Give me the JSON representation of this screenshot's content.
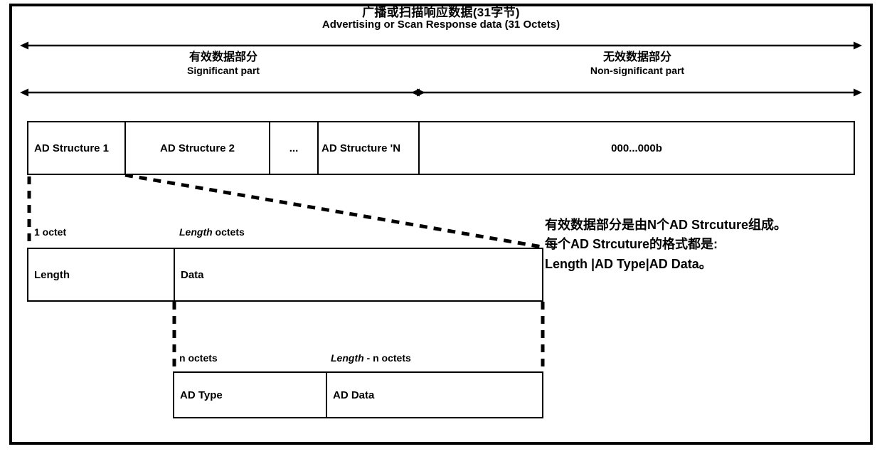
{
  "diagram": {
    "title": {
      "cn": "广播或扫描响应数据(31字节)",
      "en": "Advertising or Scan Response data (31 Octets)"
    },
    "parts": [
      {
        "cn": "有效数据部分",
        "en": "Significant part"
      },
      {
        "cn": "无效数据部分",
        "en": "Non-significant part"
      }
    ],
    "payload_row": {
      "cells": [
        "AD Structure 1",
        "AD Structure 2",
        "...",
        "AD Structure 'N",
        "000...000b"
      ]
    },
    "ad_structure_table": {
      "captions": [
        {
          "plain_before": "1 octet",
          "italic": "",
          "plain_after": ""
        },
        {
          "plain_before": "",
          "italic": "Length",
          "plain_after": " octets"
        }
      ],
      "cells": [
        "Length",
        "Data"
      ]
    },
    "ad_data_table": {
      "captions": [
        {
          "plain_before": "n octets",
          "italic": "",
          "plain_after": ""
        },
        {
          "plain_before": "",
          "italic": "Length",
          "plain_after": " - n octets"
        }
      ],
      "cells": [
        "AD Type",
        "AD Data"
      ]
    },
    "annotation": "有效数据部分是由N个AD Strcuture组成。\n每个AD Strcuture的格式都是:\nLength |AD Type|AD Data。",
    "colors": {
      "ink": "#000000",
      "paper": "#ffffff"
    }
  }
}
